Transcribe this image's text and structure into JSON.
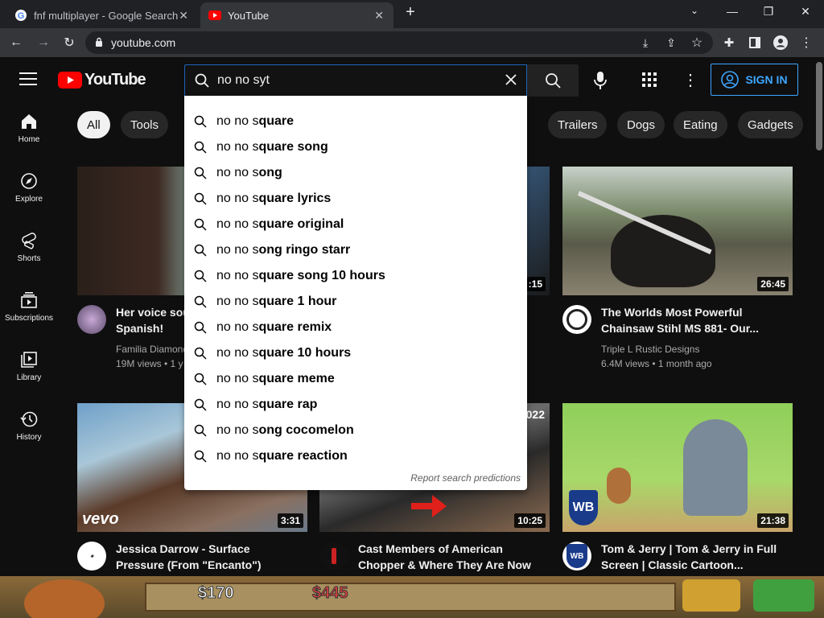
{
  "browser": {
    "tabs": [
      {
        "title": "fnf multiplayer - Google Search",
        "active": false
      },
      {
        "title": "YouTube",
        "active": true
      }
    ],
    "url": "youtube.com"
  },
  "header": {
    "logo_text": "YouTube",
    "search_value": "no no syt",
    "signin_label": "SIGN IN",
    "accent_color": "#3ea6ff"
  },
  "chips": [
    "All",
    "Tools",
    "Trailers",
    "Dogs",
    "Eating",
    "Gadgets"
  ],
  "sidebar": [
    {
      "label": "Home",
      "icon": "home-icon"
    },
    {
      "label": "Explore",
      "icon": "compass-icon"
    },
    {
      "label": "Shorts",
      "icon": "shorts-icon"
    },
    {
      "label": "Subscriptions",
      "icon": "subscriptions-icon"
    },
    {
      "label": "Library",
      "icon": "library-icon"
    },
    {
      "label": "History",
      "icon": "history-icon"
    }
  ],
  "suggestions": [
    {
      "prefix": "no no s",
      "rest": "quare"
    },
    {
      "prefix": "no no s",
      "rest": "quare song"
    },
    {
      "prefix": "no no s",
      "rest": "ong"
    },
    {
      "prefix": "no no s",
      "rest": "quare lyrics"
    },
    {
      "prefix": "no no s",
      "rest": "quare original"
    },
    {
      "prefix": "no no s",
      "rest": "ong ringo starr"
    },
    {
      "prefix": "no no s",
      "rest": "quare song 10 hours"
    },
    {
      "prefix": "no no s",
      "rest": "quare 1 hour"
    },
    {
      "prefix": "no no s",
      "rest": "quare remix"
    },
    {
      "prefix": "no no s",
      "rest": "quare 10 hours"
    },
    {
      "prefix": "no no s",
      "rest": "quare meme"
    },
    {
      "prefix": "no no s",
      "rest": "quare rap"
    },
    {
      "prefix": "no no s",
      "rest": "ong cocomelon"
    },
    {
      "prefix": "no no s",
      "rest": "quare reaction"
    }
  ],
  "report_label": "Report search predictions",
  "videos": [
    {
      "title1": "Her voice sou",
      "title2": "Spanish!",
      "channel": "Familia Diamond",
      "meta": "19M views • 1 y",
      "duration": ""
    },
    {
      "title1": "",
      "title2": "",
      "channel": "",
      "meta": "",
      "duration": ":15"
    },
    {
      "title1": "The Worlds Most Powerful",
      "title2": "Chainsaw Stihl MS 881- Our...",
      "channel": "Triple L Rustic Designs",
      "meta": "6.4M views • 1 month ago",
      "duration": "26:45"
    },
    {
      "title1": "Jessica Darrow - Surface",
      "title2": "Pressure (From \"Encanto\")",
      "channel": "",
      "meta": "",
      "duration": "3:31",
      "badge": "vevo"
    },
    {
      "title1": "Cast Members of American",
      "title2": "Chopper & Where They Are Now",
      "channel": "",
      "meta": "",
      "duration": "10:25",
      "badge": "022"
    },
    {
      "title1": "Tom & Jerry | Tom & Jerry in Full",
      "title2": "Screen | Classic Cartoon...",
      "channel": "",
      "meta": "",
      "duration": "21:38"
    }
  ],
  "game": {
    "value1": "$170",
    "value2": "$445"
  }
}
